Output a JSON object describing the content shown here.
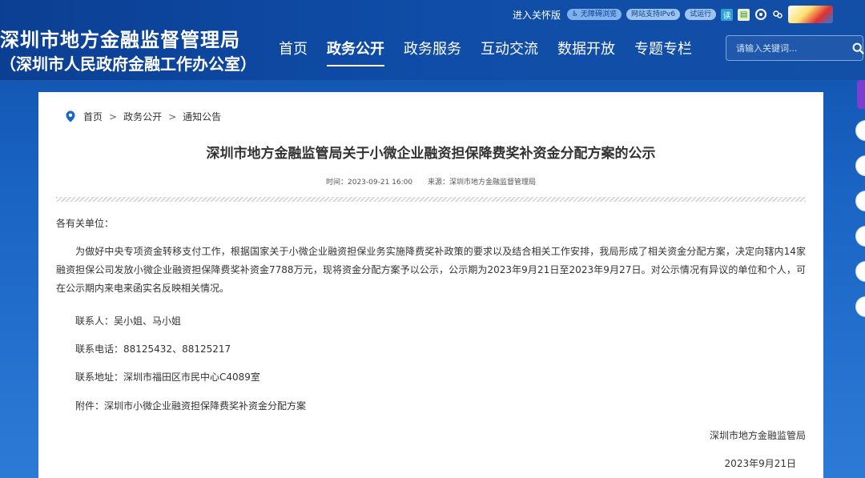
{
  "header": {
    "site_title": "深圳市地方金融监督管理局",
    "site_subtitle": "（深圳市人民政府金融工作办公室）",
    "care_link": "进入关怀版",
    "pills": [
      "无障碍浏览",
      "网站支持IPv6",
      "试运行"
    ],
    "icons": [
      "reader-icon",
      "app-icon",
      "weibo-icon",
      "wechat-icon"
    ],
    "nav": [
      "首页",
      "政务公开",
      "政务服务",
      "互动交流",
      "数据开放",
      "专题专栏"
    ],
    "active_nav": "政务公开",
    "search": {
      "placeholder": "请输入关键词..."
    }
  },
  "breadcrumb": [
    "首页",
    "政务公开",
    "通知公告"
  ],
  "article": {
    "title": "深圳市地方金融监管局关于小微企业融资担保降费奖补资金分配方案的公示",
    "time": "时间：2023-09-21 16:00",
    "source": "来源：深圳市地方金融监督管理局",
    "greeting": "各有关单位：",
    "paragraph": "为做好中央专项资金转移支付工作，根据国家关于小微企业融资担保业务实施降费奖补政策的要求以及结合相关工作安排，我局形成了相关资金分配方案，决定向辖内14家融资担保公司发放小微企业融资担保降费奖补资金7788万元，现将资金分配方案予以公示，公示期为2023年9月21日至2023年9月27日。对公示情况有异议的单位和个人，可在公示期内来电来函实名反映相关情况。",
    "contact": "联系人：吴小姐、马小姐",
    "phone": "联系电话：88125432、88125217",
    "address": "联系地址：深圳市福田区市民中心C4089室",
    "attachment": "附件：深圳市小微企业融资担保降费奖补资金分配方案",
    "signature": "深圳市地方金融监管局",
    "date": "2023年9月21日"
  },
  "colors": {
    "header_bg": "#0f4da8",
    "accent": "#1a64c4"
  }
}
